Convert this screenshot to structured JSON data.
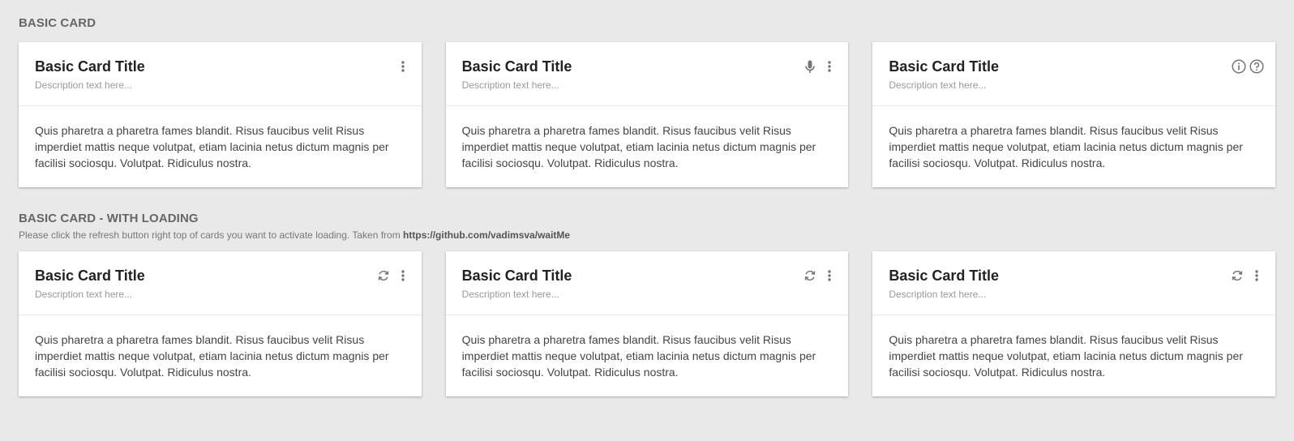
{
  "sections": [
    {
      "title": "BASIC CARD",
      "cards": [
        {
          "title": "Basic Card Title",
          "desc": "Description text here...",
          "body": "Quis pharetra a pharetra fames blandit. Risus faucibus velit Risus imperdiet mattis neque volutpat, etiam lacinia netus dictum magnis per facilisi sociosqu. Volutpat. Ridiculus nostra.",
          "icons": [
            "more-vert-icon"
          ]
        },
        {
          "title": "Basic Card Title",
          "desc": "Description text here...",
          "body": "Quis pharetra a pharetra fames blandit. Risus faucibus velit Risus imperdiet mattis neque volutpat, etiam lacinia netus dictum magnis per facilisi sociosqu. Volutpat. Ridiculus nostra.",
          "icons": [
            "microphone-icon",
            "more-vert-icon"
          ]
        },
        {
          "title": "Basic Card Title",
          "desc": "Description text here...",
          "body": "Quis pharetra a pharetra fames blandit. Risus faucibus velit Risus imperdiet mattis neque volutpat, etiam lacinia netus dictum magnis per facilisi sociosqu. Volutpat. Ridiculus nostra.",
          "icons": [
            "info-icon",
            "help-icon"
          ]
        }
      ]
    },
    {
      "title": "BASIC CARD - WITH LOADING",
      "description_prefix": "Please click the refresh button right top of cards you want to activate loading. Taken from ",
      "description_link": "https://github.com/vadimsva/waitMe",
      "cards": [
        {
          "title": "Basic Card Title",
          "desc": "Description text here...",
          "body": "Quis pharetra a pharetra fames blandit. Risus faucibus velit Risus imperdiet mattis neque volutpat, etiam lacinia netus dictum magnis per facilisi sociosqu. Volutpat. Ridiculus nostra.",
          "icons": [
            "refresh-icon",
            "more-vert-icon"
          ]
        },
        {
          "title": "Basic Card Title",
          "desc": "Description text here...",
          "body": "Quis pharetra a pharetra fames blandit. Risus faucibus velit Risus imperdiet mattis neque volutpat, etiam lacinia netus dictum magnis per facilisi sociosqu. Volutpat. Ridiculus nostra.",
          "icons": [
            "refresh-icon",
            "more-vert-icon"
          ]
        },
        {
          "title": "Basic Card Title",
          "desc": "Description text here...",
          "body": "Quis pharetra a pharetra fames blandit. Risus faucibus velit Risus imperdiet mattis neque volutpat, etiam lacinia netus dictum magnis per facilisi sociosqu. Volutpat. Ridiculus nostra.",
          "icons": [
            "refresh-icon",
            "more-vert-icon"
          ]
        }
      ]
    }
  ],
  "colors": {
    "background": "#e9e9e9",
    "card": "#ffffff",
    "icon": "#757575"
  }
}
